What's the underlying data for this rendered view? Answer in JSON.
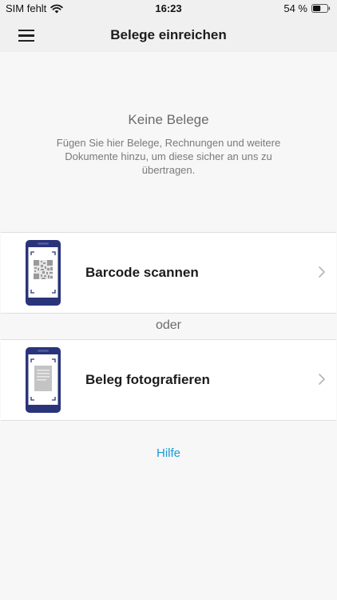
{
  "status_bar": {
    "carrier": "SIM fehlt",
    "time": "16:23",
    "battery": "54 %",
    "battery_level": 0.54
  },
  "nav": {
    "title": "Belege einreichen",
    "menu_icon": "hamburger-menu-icon"
  },
  "empty_state": {
    "title": "Keine Belege",
    "description": "Fügen Sie hier Belege, Rechnungen und weitere Dokumente hinzu, um diese sicher an uns zu übertragen."
  },
  "actions": [
    {
      "label": "Barcode scannen",
      "icon": "phone-qr-icon"
    },
    {
      "label": "Beleg fotografieren",
      "icon": "phone-document-icon"
    }
  ],
  "separator": "oder",
  "help_link": "Hilfe",
  "colors": {
    "accent": "#1a9ad6",
    "phone_frame": "#2a347a",
    "background": "#f7f7f7",
    "bar": "#f0f0f0"
  }
}
